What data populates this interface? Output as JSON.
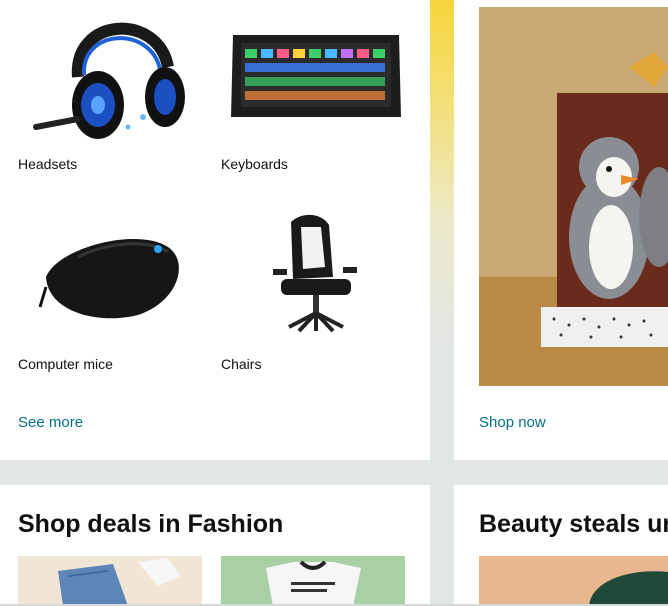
{
  "gaming_card": {
    "tiles": [
      {
        "label": "Headsets"
      },
      {
        "label": "Keyboards"
      },
      {
        "label": "Computer mice"
      },
      {
        "label": "Chairs"
      }
    ],
    "link_label": "See more"
  },
  "gift_card": {
    "link_label": "Shop now"
  },
  "fashion_card": {
    "title": "Shop deals in Fashion"
  },
  "beauty_card": {
    "title": "Beauty steals ur"
  },
  "colors": {
    "link": "#007185",
    "hero_yellow": "#f7d63a",
    "page_bg": "#e3e6e6"
  }
}
